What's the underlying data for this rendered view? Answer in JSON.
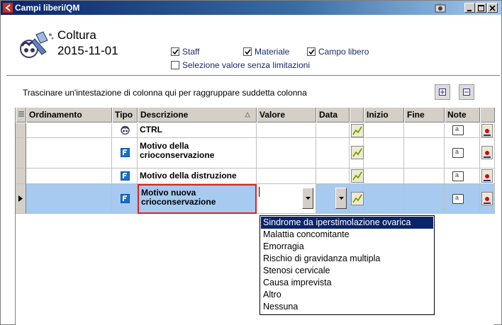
{
  "window": {
    "title": "Campi liberi/QM"
  },
  "header": {
    "title": "Coltura",
    "date": "2015-11-01",
    "checkboxes": {
      "staff": {
        "label": "Staff",
        "checked": true
      },
      "materiale": {
        "label": "Materiale",
        "checked": true
      },
      "campo_libero": {
        "label": "Campo libero",
        "checked": true
      },
      "selezione": {
        "label": "Selezione valore senza limitazioni",
        "checked": false
      }
    }
  },
  "groupbar": {
    "hint": "Trascinare un'intestazione di colonna qui per raggruppare suddetta colonna"
  },
  "grid": {
    "columns": {
      "ordinamento": "Ordinamento",
      "tipo": "Tipo",
      "descrizione": "Descrizione",
      "valore": "Valore",
      "data": "Data",
      "inizio": "Inizio",
      "fine": "Fine",
      "note": "Note"
    },
    "rows": [
      {
        "descrizione": "CTRL",
        "tipo_icon": "people-icon"
      },
      {
        "descrizione": "Motivo della crioconservazione",
        "tipo_icon": "field-f-icon"
      },
      {
        "descrizione": "Motivo della distruzione",
        "tipo_icon": "field-f-icon"
      },
      {
        "descrizione": "Motivo nuova crioconservazione",
        "tipo_icon": "field-f-icon",
        "selected": true
      }
    ]
  },
  "dropdown": {
    "options": [
      "Sindrome da iperstimolazione ovarica",
      "Malattia concomitante",
      "Emorragia",
      "Rischio di gravidanza multipla",
      "Stenosi cervicale",
      "Causa imprevista",
      "Altro",
      "Nessuna"
    ],
    "highlighted_index": 0
  },
  "colors": {
    "title_bar": "#0a246a",
    "selection": "#a6caf0",
    "highlight": "#0a246a",
    "focus_border": "#e02020"
  }
}
